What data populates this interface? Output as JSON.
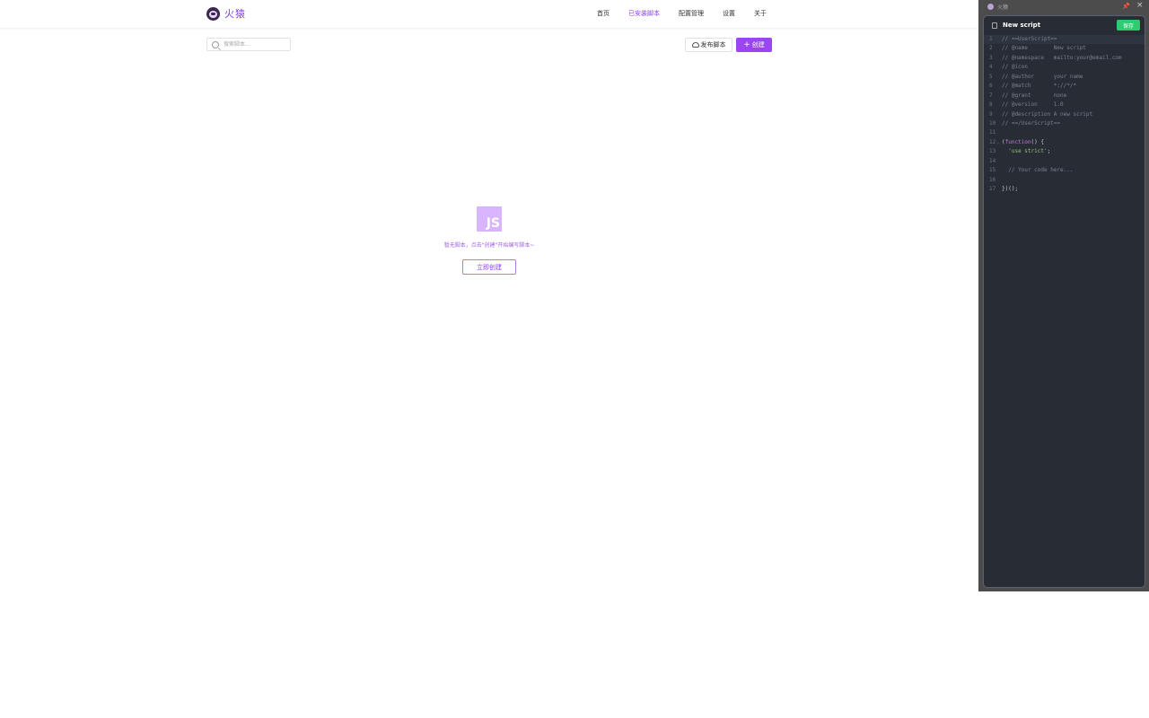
{
  "app": {
    "name": "火猿"
  },
  "nav": {
    "items": [
      "首页",
      "已安装脚本",
      "配置管理",
      "设置",
      "关于"
    ],
    "active_index": 1
  },
  "toolbar": {
    "search_placeholder": "搜索脚本...",
    "publish_label": "发布脚本",
    "create_label": "创建",
    "plus": "+"
  },
  "empty_state": {
    "logo_text": "JS",
    "message": "暂无脚本，点击\"创建\"开始编写脚本~",
    "create_now_label": "立即创建"
  },
  "panel": {
    "app_name": "火猿",
    "pin_glyph": "📌",
    "close_glyph": "×",
    "editor_title": "New script",
    "save_label": "保存",
    "code_lines": [
      {
        "n": "1",
        "parts": [
          [
            "c",
            "// ==UserScript=="
          ]
        ]
      },
      {
        "n": "2",
        "parts": [
          [
            "c",
            "// @name        New script"
          ]
        ]
      },
      {
        "n": "3",
        "parts": [
          [
            "c",
            "// @namespace   mailto:your@email.com"
          ]
        ]
      },
      {
        "n": "4",
        "parts": [
          [
            "c",
            "// @icon"
          ]
        ]
      },
      {
        "n": "5",
        "parts": [
          [
            "c",
            "// @author      your name"
          ]
        ]
      },
      {
        "n": "6",
        "parts": [
          [
            "c",
            "// @match       *://*/*"
          ]
        ]
      },
      {
        "n": "7",
        "parts": [
          [
            "c",
            "// @grant       none"
          ]
        ]
      },
      {
        "n": "8",
        "parts": [
          [
            "c",
            "// @version     1.0"
          ]
        ]
      },
      {
        "n": "9",
        "parts": [
          [
            "c",
            "// @description A new script"
          ]
        ]
      },
      {
        "n": "10",
        "parts": [
          [
            "c",
            "// ==/UserScript=="
          ]
        ]
      },
      {
        "n": "11",
        "parts": []
      },
      {
        "n": "12",
        "fold": true,
        "parts": [
          [
            "src",
            "("
          ],
          [
            "k",
            "function"
          ],
          [
            "src",
            "() {"
          ]
        ]
      },
      {
        "n": "13",
        "parts": [
          [
            "src",
            "  "
          ],
          [
            "s",
            "'use strict'"
          ],
          [
            "src",
            ";"
          ]
        ]
      },
      {
        "n": "14",
        "parts": []
      },
      {
        "n": "15",
        "parts": [
          [
            "src",
            "  "
          ],
          [
            "c",
            "// Your code here..."
          ]
        ]
      },
      {
        "n": "16",
        "parts": []
      },
      {
        "n": "17",
        "parts": [
          [
            "src",
            "})();"
          ]
        ]
      }
    ]
  },
  "colors": {
    "accent": "#9b45f0",
    "save_green": "#2ecc71",
    "editor_bg": "#272c35"
  }
}
